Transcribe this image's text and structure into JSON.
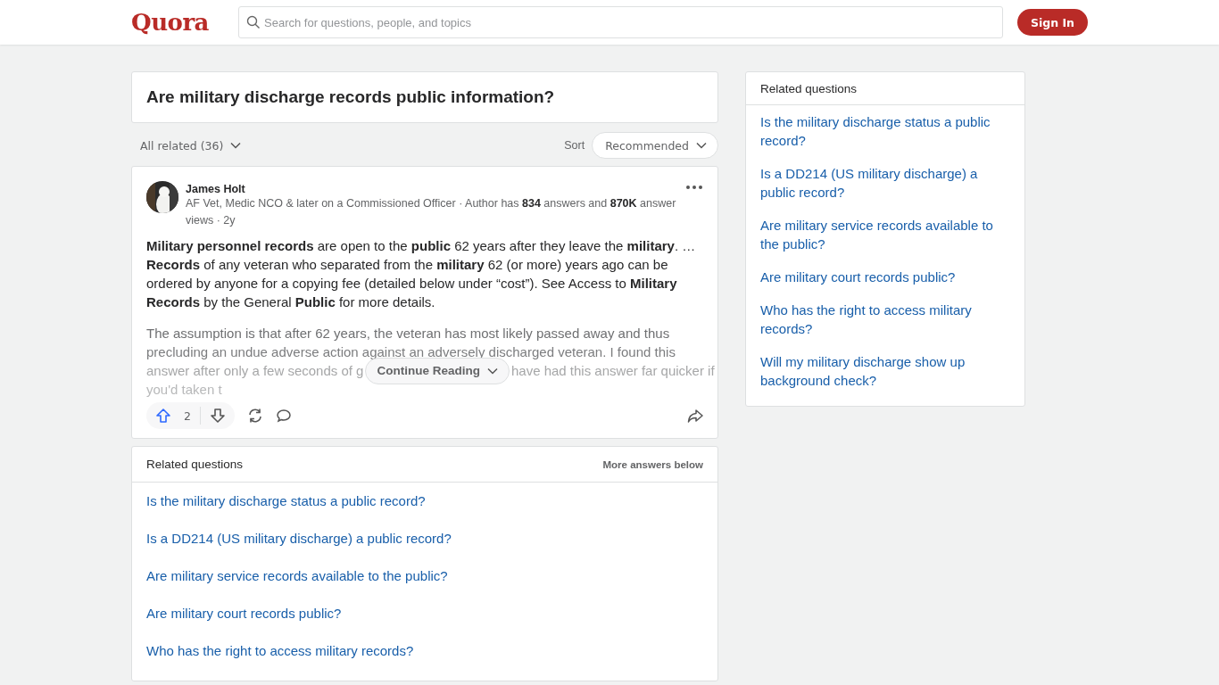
{
  "header": {
    "logo": "Quora",
    "search": {
      "placeholder": "Search for questions, people, and topics"
    },
    "sign_in": "Sign In"
  },
  "question": {
    "title": "Are military discharge records public information?"
  },
  "filter": {
    "all_related": "All related (36)",
    "sort_label": "Sort",
    "sort_value": "Recommended"
  },
  "answer": {
    "author": "James Holt",
    "credential": "AF Vet, Medic NCO & later on a Commissioned Officer · Author has **834** answers and **870K** answer views · 2y",
    "body": "**Military personnel records** are open to the **public** 62 years after they leave the **military**. … **Records** of any veteran who separated from the **military** 62 (or more) years ago can be ordered by anyone for a copying fee (detailed below under “cost”). See Access to **Military Records** by the General **Public** for more details.",
    "preview_lines": [
      {
        "text": "The assumption is that after 62 years, the veteran has most likely passed away and thus"
      },
      {
        "text": "precluding an undue adverse action against an adversely discharged veteran. I found this"
      },
      {
        "text": "answer after only a few seconds of g",
        "after": "have had this answer far quicker if"
      },
      {
        "text": "you'd taken t"
      }
    ],
    "continue": "Continue Reading",
    "upvotes": "2"
  },
  "related_inline": {
    "title": "Related questions",
    "note": "More answers below",
    "items": [
      "Is the military discharge status a public record?",
      "Is a DD214 (US military discharge) a public record?",
      "Are military service records available to the public?",
      "Are military court records public?",
      "Who has the right to access military records?"
    ]
  },
  "sidebar": {
    "title": "Related questions",
    "items": [
      "Is the military discharge status a public record?",
      "Is a DD214 (US military discharge) a public record?",
      "Are military service records available to the public?",
      "Are military court records public?",
      "Who has the right to access military records?",
      "Will my military discharge show up background check?"
    ]
  }
}
